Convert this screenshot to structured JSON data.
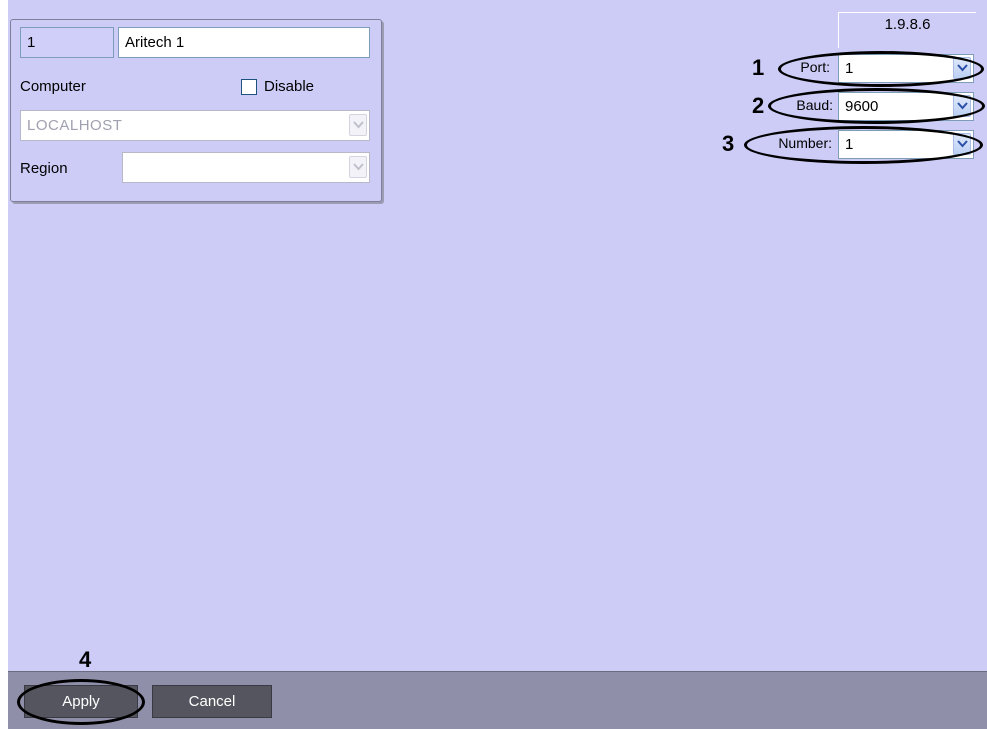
{
  "object": {
    "id_value": "1",
    "name_value": "Aritech 1",
    "computer_label": "Computer",
    "disable_label": "Disable",
    "disable_checked": false,
    "computer_value": "LOCALHOST",
    "region_label": "Region",
    "region_value": ""
  },
  "version": "1.9.8.6",
  "settings": {
    "port_label": "Port:",
    "port_value": "1",
    "baud_label": "Baud:",
    "baud_value": "9600",
    "number_label": "Number:",
    "number_value": "1"
  },
  "callouts": {
    "port": "1",
    "baud": "2",
    "number": "3",
    "apply": "4"
  },
  "footer": {
    "apply_label": "Apply",
    "cancel_label": "Cancel"
  },
  "icons": {
    "combo_arrow": "chevron-down-icon"
  },
  "colors": {
    "panel_background": "#ccccf7",
    "footer_background": "#8f8fa9",
    "button_background": "#55555f"
  }
}
